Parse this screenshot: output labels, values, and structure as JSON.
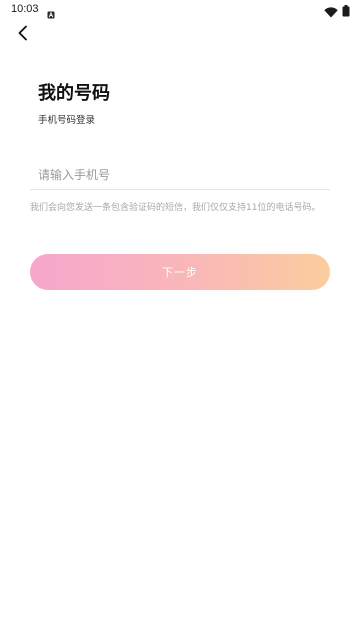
{
  "status_bar": {
    "time": "10:03",
    "notification_icon": "a-notification-icon",
    "wifi_icon": "wifi-icon",
    "battery_icon": "battery-icon"
  },
  "header": {
    "back_icon": "chevron-left-icon"
  },
  "main": {
    "title": "我的号码",
    "subtitle": "手机号码登录",
    "phone_input": {
      "placeholder": "请输入手机号",
      "value": ""
    },
    "hint": "我们会向您发送一条包含验证码的短信，我们仅仅支持11位的电话号码。",
    "next_button_label": "下一步"
  },
  "colors": {
    "button_gradient_start": "#f7a6cd",
    "button_gradient_end": "#fbcd9d",
    "hint_text": "#a8a8a8"
  }
}
